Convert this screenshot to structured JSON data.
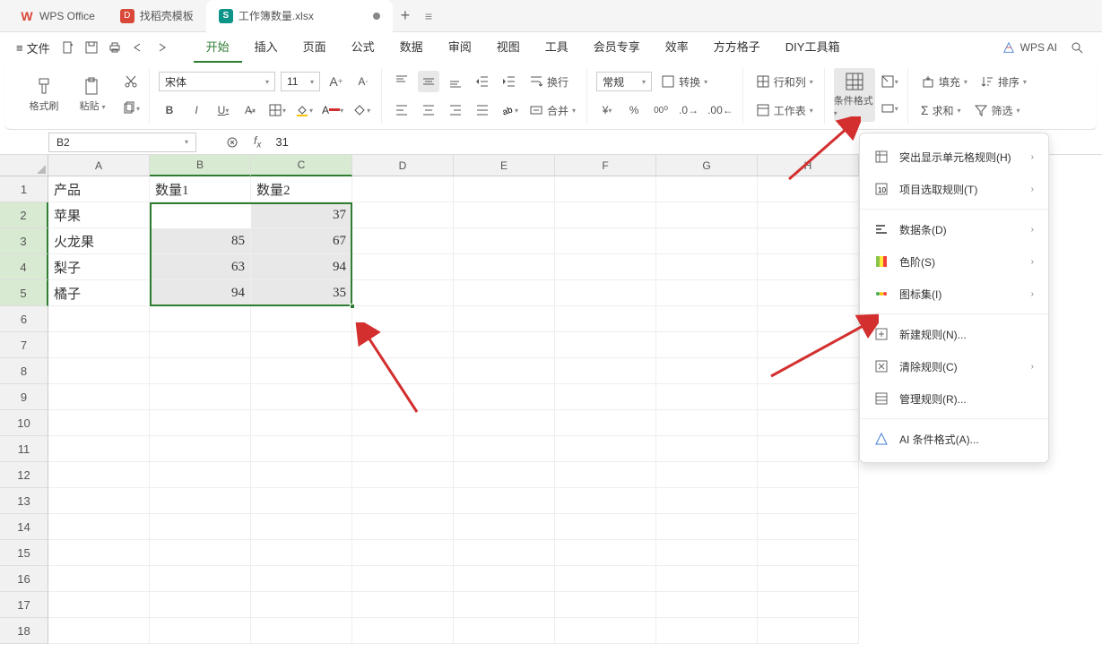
{
  "title_tabs": {
    "wps": "WPS Office",
    "docer": "找稻壳模板",
    "file": "工作簿数量.xlsx"
  },
  "menu": {
    "file": "文件",
    "tabs": [
      "开始",
      "插入",
      "页面",
      "公式",
      "数据",
      "审阅",
      "视图",
      "工具",
      "会员专享",
      "效率",
      "方方格子",
      "DIY工具箱"
    ],
    "wps_ai": "WPS AI"
  },
  "ribbon": {
    "format_painter": "格式刷",
    "paste": "粘贴",
    "font_name": "宋体",
    "font_size": "11",
    "number_format": "常规",
    "wrap": "换行",
    "merge": "合并",
    "convert": "转换",
    "rows_cols": "行和列",
    "worksheet": "工作表",
    "cond_format": "条件格式",
    "fill": "填充",
    "sort": "排序",
    "sum": "求和",
    "filter": "筛选"
  },
  "namebox": "B2",
  "formula": "31",
  "columns": [
    "A",
    "B",
    "C",
    "D",
    "E",
    "F",
    "G",
    "H"
  ],
  "rows": [
    "1",
    "2",
    "3",
    "4",
    "5",
    "6",
    "7",
    "8",
    "9",
    "10",
    "11",
    "12",
    "13",
    "14",
    "15",
    "16",
    "17",
    "18"
  ],
  "headers": [
    "产品",
    "数量1",
    "数量2"
  ],
  "data": [
    {
      "prod": "苹果",
      "q1": "31",
      "q2": "37"
    },
    {
      "prod": "火龙果",
      "q1": "85",
      "q2": "67"
    },
    {
      "prod": "梨子",
      "q1": "63",
      "q2": "94"
    },
    {
      "prod": "橘子",
      "q1": "94",
      "q2": "35"
    }
  ],
  "menu_items": {
    "highlight": "突出显示单元格规则(H)",
    "top_bottom": "项目选取规则(T)",
    "data_bars": "数据条(D)",
    "color_scales": "色阶(S)",
    "icon_sets": "图标集(I)",
    "new_rule": "新建规则(N)...",
    "clear_rules": "清除规则(C)",
    "manage_rules": "管理规则(R)...",
    "ai_format": "AI 条件格式(A)..."
  }
}
